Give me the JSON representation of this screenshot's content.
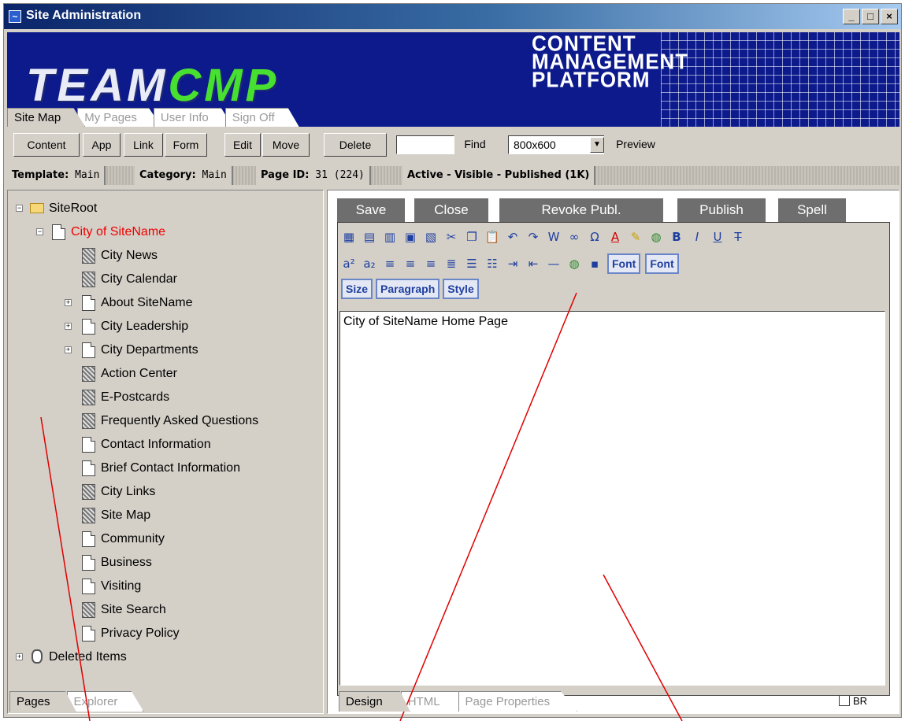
{
  "window": {
    "title": "Site Administration"
  },
  "banner": {
    "logo_part1": "TEAM",
    "logo_part2": "CMP",
    "tagline_line1": "CONTENT",
    "tagline_line2": "MANAGEMENT",
    "tagline_line3": "PLATFORM",
    "tabs": [
      "Site Map",
      "My Pages",
      "User Info",
      "Sign Off"
    ]
  },
  "toolbar": {
    "content": "Content",
    "app": "App",
    "link": "Link",
    "form": "Form",
    "edit": "Edit",
    "move": "Move",
    "delete": "Delete",
    "find_value": "",
    "find": "Find",
    "resolution": "800x600",
    "preview": "Preview"
  },
  "status": {
    "template_label": "Template:",
    "template": "Main",
    "category_label": "Category:",
    "category": "Main",
    "pageid_label": "Page ID:",
    "pageid": "31 (224)",
    "state": "Active - Visible - Published  (1K)"
  },
  "tree": {
    "root": "SiteRoot",
    "city": "City of SiteName",
    "items": [
      "City News",
      "City Calendar",
      "About SiteName",
      "City Leadership",
      "City Departments",
      "Action Center",
      "E-Postcards",
      "Frequently Asked Questions",
      "Contact Information",
      "Brief Contact Information",
      "City Links",
      "Site Map",
      "Community",
      "Business",
      "Visiting",
      "Site Search",
      "Privacy Policy"
    ],
    "deleted": "Deleted Items"
  },
  "left_tabs": [
    "Pages",
    "Explorer"
  ],
  "actions": [
    "Save",
    "Close",
    "Revoke Publ.",
    "Publish",
    "Spell"
  ],
  "editor": {
    "font_btn1": "Font",
    "font_btn2": "Font",
    "size_btn": "Size",
    "paragraph_btn": "Paragraph",
    "style_btn": "Style",
    "content": "City of SiteName Home Page"
  },
  "bottom_tabs": [
    "Design",
    "HTML",
    "Page Properties"
  ],
  "br_label": "BR",
  "colors": {
    "banner": "#0c1a8c",
    "accent_green": "#48e030",
    "tree_highlight": "#f00000",
    "action_button": "#6e6e6e"
  }
}
